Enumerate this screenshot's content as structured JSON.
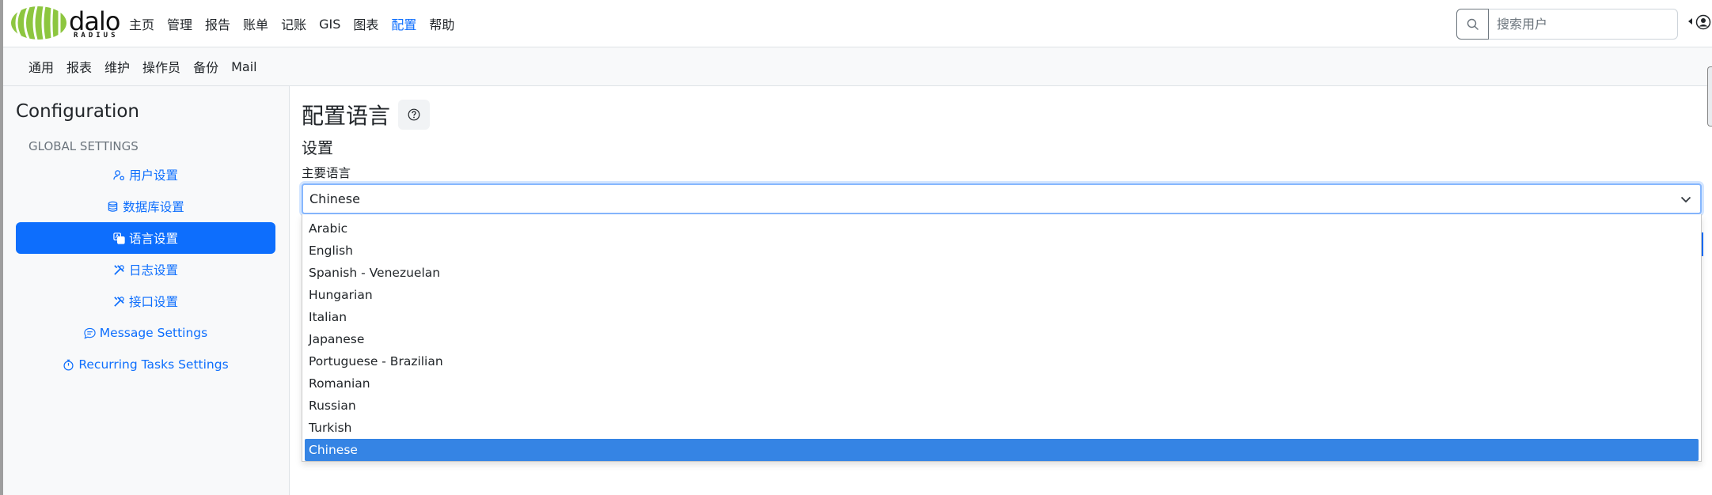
{
  "brand": {
    "name": "dalo",
    "sub": "RADIUS",
    "logo_color": "#8dc63f"
  },
  "nav": {
    "items": [
      "主页",
      "管理",
      "报告",
      "账单",
      "记账",
      "GIS",
      "图表",
      "配置",
      "帮助"
    ],
    "active": "配置"
  },
  "search": {
    "placeholder": "搜索用户",
    "value": ""
  },
  "subnav": {
    "items": [
      "通用",
      "报表",
      "维护",
      "操作员",
      "备份",
      "Mail"
    ]
  },
  "sidebar": {
    "title": "Configuration",
    "section": "GLOBAL SETTINGS",
    "items": [
      {
        "label": "用户设置",
        "icon": "person-gear-icon",
        "active": false
      },
      {
        "label": "数据库设置",
        "icon": "database-icon",
        "active": false
      },
      {
        "label": "语言设置",
        "icon": "translate-icon",
        "active": true
      },
      {
        "label": "日志设置",
        "icon": "tools-icon",
        "active": false
      },
      {
        "label": "接口设置",
        "icon": "tools-icon",
        "active": false
      },
      {
        "label": "Message Settings",
        "icon": "chat-icon",
        "active": false
      },
      {
        "label": "Recurring Tasks Settings",
        "icon": "stopwatch-icon",
        "active": false
      }
    ]
  },
  "main": {
    "title": "配置语言",
    "section": "设置",
    "field_label": "主要语言",
    "selected": "Chinese",
    "options": [
      "Arabic",
      "English",
      "Spanish - Venezuelan",
      "Hungarian",
      "Italian",
      "Japanese",
      "Portuguese - Brazilian",
      "Romanian",
      "Russian",
      "Turkish",
      "Chinese"
    ]
  },
  "colors": {
    "accent": "#0d6efd",
    "dropdown_highlight": "#3584e4"
  }
}
